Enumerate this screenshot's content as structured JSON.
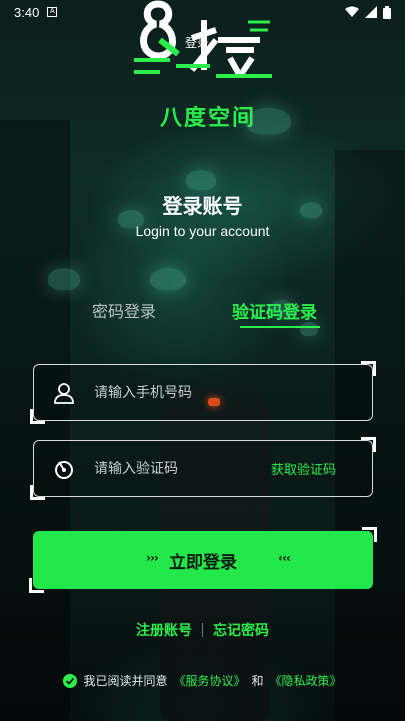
{
  "status_bar": {
    "time": "3:40",
    "notif_letter": "A"
  },
  "logo": {
    "small_text": "登录"
  },
  "brand": {
    "name": "八度空间"
  },
  "header": {
    "title": "登录账号",
    "subtitle": "Login to your account"
  },
  "tabs": [
    {
      "label": "密码登录",
      "active": false
    },
    {
      "label": "验证码登录",
      "active": true
    }
  ],
  "phone_field": {
    "placeholder": "请输入手机号码",
    "value": ""
  },
  "code_field": {
    "placeholder": "请输入验证码",
    "value": "",
    "action_label": "获取验证码"
  },
  "login_button": {
    "label": "立即登录",
    "left_arrows": "›››",
    "right_arrows": "‹‹‹"
  },
  "links": {
    "register": "注册账号",
    "forgot": "忘记密码"
  },
  "agreement": {
    "prefix": "我已阅读并同意",
    "service": "《服务协议》",
    "and": "和",
    "privacy": "《隐私政策》",
    "checked": true
  },
  "colors": {
    "accent": "#2bf04b",
    "button": "#22e84a"
  }
}
